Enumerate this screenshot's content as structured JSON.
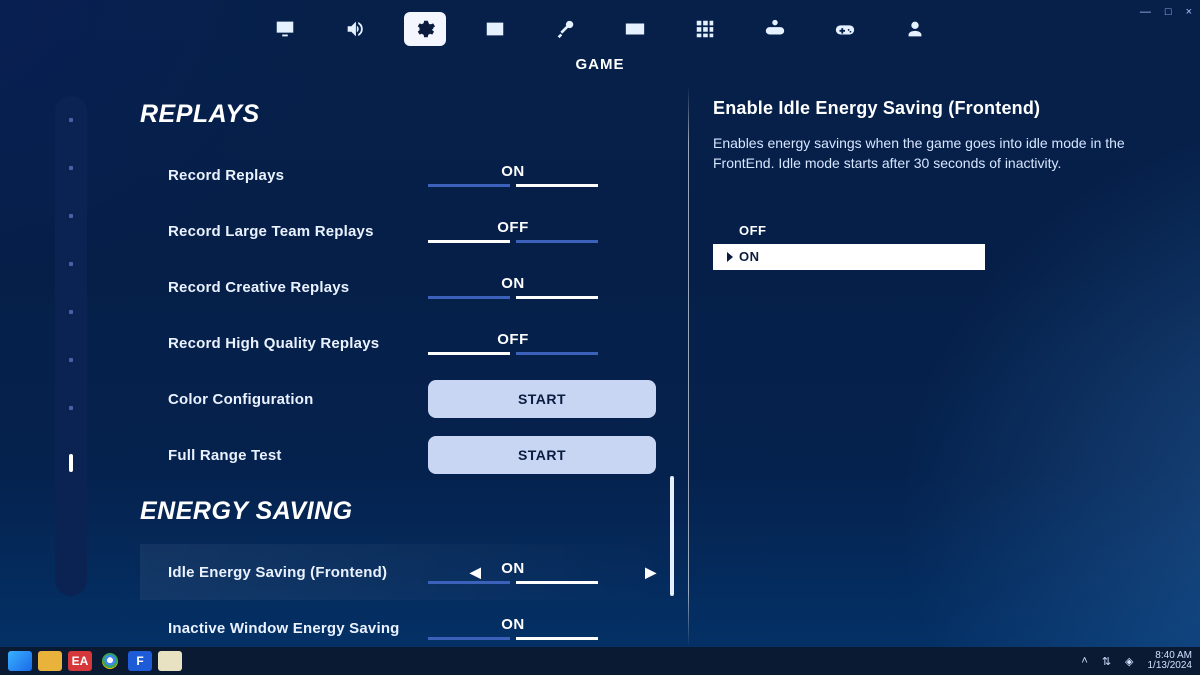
{
  "topnav": {
    "selected_index": 2,
    "selected_label": "GAME",
    "tabs": [
      "display",
      "audio",
      "game",
      "ui",
      "diagnostics",
      "keyboard",
      "hud",
      "devgame",
      "controller",
      "account"
    ]
  },
  "rail": {
    "count": 8,
    "active_index": 7
  },
  "settings": {
    "sections": [
      {
        "title": "Replays",
        "rows": [
          {
            "kind": "toggle",
            "label": "Record Replays",
            "value": "ON"
          },
          {
            "kind": "toggle",
            "label": "Record Large Team Replays",
            "value": "OFF"
          },
          {
            "kind": "toggle",
            "label": "Record Creative Replays",
            "value": "ON"
          },
          {
            "kind": "toggle",
            "label": "Record High Quality Replays",
            "value": "OFF"
          },
          {
            "kind": "button",
            "label": "Color Configuration",
            "button": "START"
          },
          {
            "kind": "button",
            "label": "Full Range Test",
            "button": "START"
          }
        ]
      },
      {
        "title": "Energy Saving",
        "rows": [
          {
            "kind": "toggle",
            "label": "Idle Energy Saving (Frontend)",
            "value": "ON",
            "selected": true
          },
          {
            "kind": "toggle",
            "label": "Inactive Window Energy Saving",
            "value": "ON"
          }
        ]
      }
    ]
  },
  "help": {
    "title": "Enable Idle Energy Saving (Frontend)",
    "body": "Enables energy savings when the game goes into idle mode in the FrontEnd. Idle mode starts after 30 seconds of inactivity.",
    "options": [
      {
        "label": "OFF",
        "selected": false
      },
      {
        "label": "ON",
        "selected": true
      }
    ]
  },
  "window_controls": {
    "minimize": "—",
    "maximize": "□",
    "close": "×"
  },
  "taskbar": {
    "time": "8:40 AM",
    "date": "1/13/2024"
  }
}
